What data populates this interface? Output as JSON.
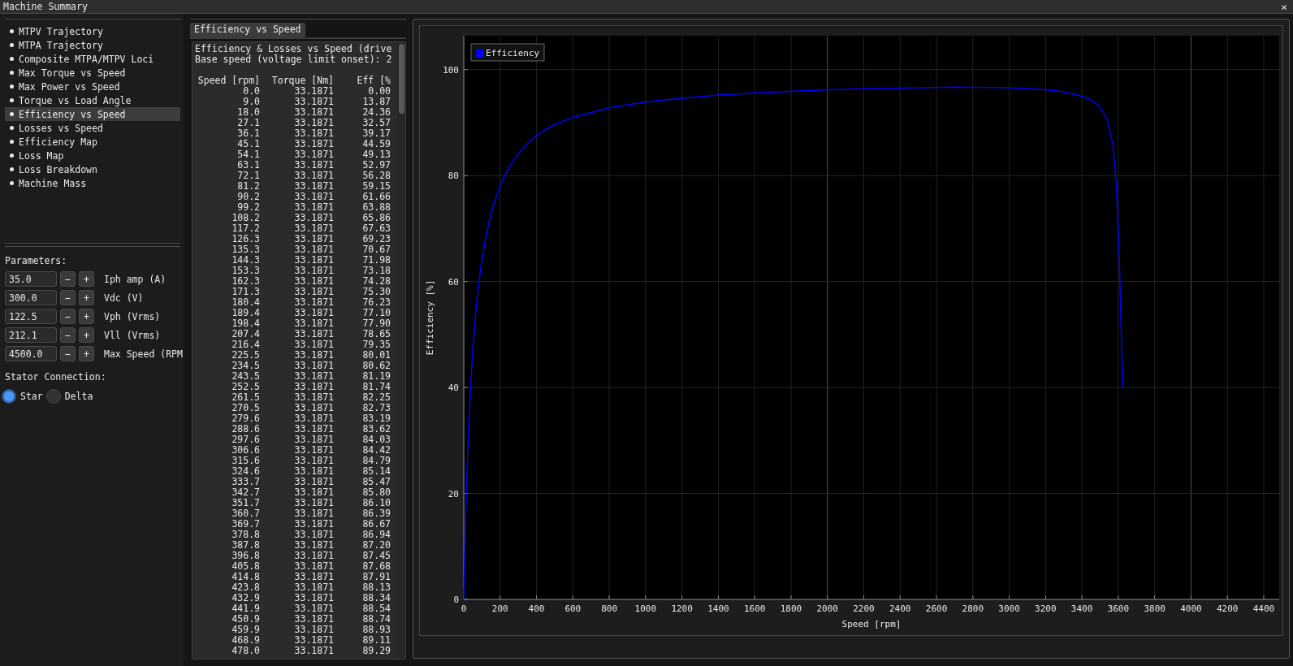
{
  "window": {
    "title": "Machine Summary",
    "close": "×"
  },
  "sidebar": {
    "items": [
      {
        "label": "MTPV Trajectory",
        "selected": false
      },
      {
        "label": "MTPA Trajectory",
        "selected": false
      },
      {
        "label": "Composite MTPA/MTPV Loci",
        "selected": false
      },
      {
        "label": "Max Torque vs Speed",
        "selected": false
      },
      {
        "label": "Max Power vs Speed",
        "selected": false
      },
      {
        "label": "Torque vs Load Angle",
        "selected": false
      },
      {
        "label": "Efficiency vs Speed",
        "selected": true
      },
      {
        "label": "Losses vs Speed",
        "selected": false
      },
      {
        "label": "Efficiency Map",
        "selected": false
      },
      {
        "label": "Loss Map",
        "selected": false
      },
      {
        "label": "Loss Breakdown",
        "selected": false
      },
      {
        "label": "Machine Mass",
        "selected": false
      }
    ]
  },
  "parameters": {
    "title": "Parameters:",
    "items": [
      {
        "value": "35.0",
        "label": "Iph amp (A)"
      },
      {
        "value": "300.0",
        "label": "Vdc (V)"
      },
      {
        "value": "122.5",
        "label": "Vph (Vrms)"
      },
      {
        "value": "212.1",
        "label": "Vll (Vrms)"
      },
      {
        "value": "4500.0",
        "label": "Max Speed (RPM"
      }
    ],
    "minus": "−",
    "plus": "+"
  },
  "stator_connection": {
    "title": "Stator Connection:",
    "options": [
      {
        "label": "Star",
        "selected": true
      },
      {
        "label": "Delta",
        "selected": false
      }
    ]
  },
  "tab": {
    "label": "Efficiency vs Speed",
    "selected": true
  },
  "report": {
    "lines": [
      "Efficiency & Losses vs Speed (drive",
      "Base speed (voltage limit onset): 2"
    ],
    "columns": [
      "Speed [rpm]",
      "Torque [Nm]",
      "Eff [%"
    ],
    "rows": [
      [
        "0.0",
        "33.1871",
        "0.00"
      ],
      [
        "9.0",
        "33.1871",
        "13.87"
      ],
      [
        "18.0",
        "33.1871",
        "24.36"
      ],
      [
        "27.1",
        "33.1871",
        "32.57"
      ],
      [
        "36.1",
        "33.1871",
        "39.17"
      ],
      [
        "45.1",
        "33.1871",
        "44.59"
      ],
      [
        "54.1",
        "33.1871",
        "49.13"
      ],
      [
        "63.1",
        "33.1871",
        "52.97"
      ],
      [
        "72.1",
        "33.1871",
        "56.28"
      ],
      [
        "81.2",
        "33.1871",
        "59.15"
      ],
      [
        "90.2",
        "33.1871",
        "61.66"
      ],
      [
        "99.2",
        "33.1871",
        "63.88"
      ],
      [
        "108.2",
        "33.1871",
        "65.86"
      ],
      [
        "117.2",
        "33.1871",
        "67.63"
      ],
      [
        "126.3",
        "33.1871",
        "69.23"
      ],
      [
        "135.3",
        "33.1871",
        "70.67"
      ],
      [
        "144.3",
        "33.1871",
        "71.98"
      ],
      [
        "153.3",
        "33.1871",
        "73.18"
      ],
      [
        "162.3",
        "33.1871",
        "74.28"
      ],
      [
        "171.3",
        "33.1871",
        "75.30"
      ],
      [
        "180.4",
        "33.1871",
        "76.23"
      ],
      [
        "189.4",
        "33.1871",
        "77.10"
      ],
      [
        "198.4",
        "33.1871",
        "77.90"
      ],
      [
        "207.4",
        "33.1871",
        "78.65"
      ],
      [
        "216.4",
        "33.1871",
        "79.35"
      ],
      [
        "225.5",
        "33.1871",
        "80.01"
      ],
      [
        "234.5",
        "33.1871",
        "80.62"
      ],
      [
        "243.5",
        "33.1871",
        "81.19"
      ],
      [
        "252.5",
        "33.1871",
        "81.74"
      ],
      [
        "261.5",
        "33.1871",
        "82.25"
      ],
      [
        "270.5",
        "33.1871",
        "82.73"
      ],
      [
        "279.6",
        "33.1871",
        "83.19"
      ],
      [
        "288.6",
        "33.1871",
        "83.62"
      ],
      [
        "297.6",
        "33.1871",
        "84.03"
      ],
      [
        "306.6",
        "33.1871",
        "84.42"
      ],
      [
        "315.6",
        "33.1871",
        "84.79"
      ],
      [
        "324.6",
        "33.1871",
        "85.14"
      ],
      [
        "333.7",
        "33.1871",
        "85.47"
      ],
      [
        "342.7",
        "33.1871",
        "85.80"
      ],
      [
        "351.7",
        "33.1871",
        "86.10"
      ],
      [
        "360.7",
        "33.1871",
        "86.39"
      ],
      [
        "369.7",
        "33.1871",
        "86.67"
      ],
      [
        "378.8",
        "33.1871",
        "86.94"
      ],
      [
        "387.8",
        "33.1871",
        "87.20"
      ],
      [
        "396.8",
        "33.1871",
        "87.45"
      ],
      [
        "405.8",
        "33.1871",
        "87.68"
      ],
      [
        "414.8",
        "33.1871",
        "87.91"
      ],
      [
        "423.8",
        "33.1871",
        "88.13"
      ],
      [
        "432.9",
        "33.1871",
        "88.34"
      ],
      [
        "441.9",
        "33.1871",
        "88.54"
      ],
      [
        "450.9",
        "33.1871",
        "88.74"
      ],
      [
        "459.9",
        "33.1871",
        "88.93"
      ],
      [
        "468.9",
        "33.1871",
        "89.11"
      ],
      [
        "478.0",
        "33.1871",
        "89.29"
      ]
    ]
  },
  "chart": {
    "chart_data": {
      "type": "line",
      "xlabel": "Speed [rpm]",
      "ylabel": "Efficiency [%]",
      "x": [
        0,
        9,
        18,
        27.1,
        36.1,
        45.1,
        54.1,
        63.1,
        72.1,
        81.2,
        90.2,
        99.2,
        117.2,
        135.3,
        153.3,
        180.4,
        216.4,
        252.5,
        297.6,
        342.7,
        387.8,
        432.9,
        478,
        600,
        800,
        1000,
        1200,
        1400,
        1600,
        2000,
        2400,
        2700,
        3000,
        3200,
        3300,
        3400,
        3450,
        3500,
        3540,
        3570,
        3590,
        3605,
        3615,
        3625
      ],
      "series": [
        {
          "name": "Efficiency",
          "color": "#0000ff",
          "values": [
            0,
            13.9,
            24.4,
            32.6,
            39.2,
            44.6,
            49.1,
            53.0,
            56.3,
            59.2,
            61.7,
            63.9,
            67.6,
            70.7,
            73.2,
            76.2,
            79.4,
            81.7,
            84.0,
            85.8,
            87.2,
            88.3,
            89.3,
            91.0,
            92.8,
            93.9,
            94.6,
            95.2,
            95.6,
            96.2,
            96.5,
            96.7,
            96.6,
            96.2,
            95.8,
            95.0,
            94.3,
            93.0,
            90.5,
            86,
            78,
            65,
            52,
            40
          ]
        }
      ],
      "xlim": [
        0,
        4485
      ],
      "ylim": [
        0,
        106.4
      ],
      "xticks": [
        0,
        200,
        400,
        600,
        800,
        1000,
        1200,
        1400,
        1600,
        1800,
        2000,
        2200,
        2400,
        2600,
        2800,
        3000,
        3200,
        3400,
        3600,
        3800,
        4000,
        4200,
        4400
      ],
      "yticks": [
        0,
        20,
        40,
        60,
        80,
        100
      ],
      "grid": true
    }
  }
}
